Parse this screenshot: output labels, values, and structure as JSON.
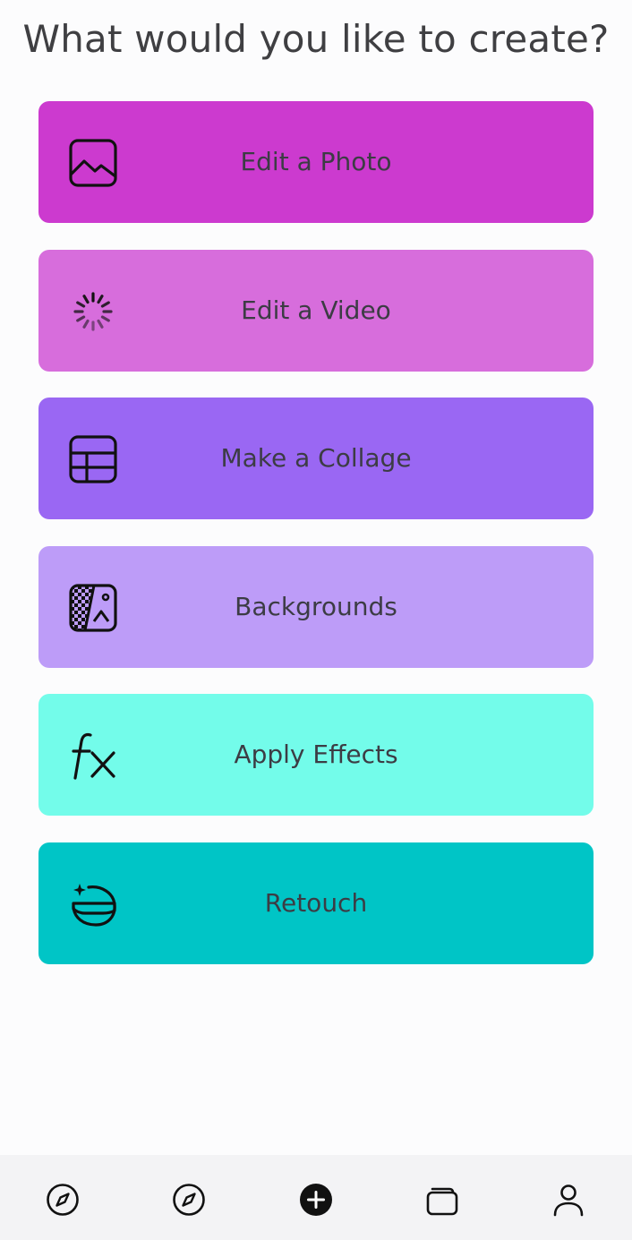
{
  "header": {
    "title": "What would you like to create?"
  },
  "colors": {
    "edit_photo": "#cc3acf",
    "edit_video": "#d76ddc",
    "collage": "#9a67f3",
    "backgrounds": "#bd9cf8",
    "effects": "#73fcea",
    "retouch": "#00c5c6",
    "icon_stroke": "#111111"
  },
  "cards": [
    {
      "label": "Edit a Photo",
      "icon": "image-icon"
    },
    {
      "label": "Edit a Video",
      "icon": "loading-spinner-icon"
    },
    {
      "label": "Make a Collage",
      "icon": "collage-layout-icon"
    },
    {
      "label": "Backgrounds",
      "icon": "background-transparent-icon"
    },
    {
      "label": "Apply Effects",
      "icon": "fx-icon"
    },
    {
      "label": "Retouch",
      "icon": "retouch-face-icon"
    }
  ],
  "bottom_nav": {
    "items": [
      {
        "icon": "compass-icon"
      },
      {
        "icon": "compass-icon"
      },
      {
        "icon": "plus-circle-icon"
      },
      {
        "icon": "folders-icon"
      },
      {
        "icon": "profile-icon"
      }
    ]
  }
}
